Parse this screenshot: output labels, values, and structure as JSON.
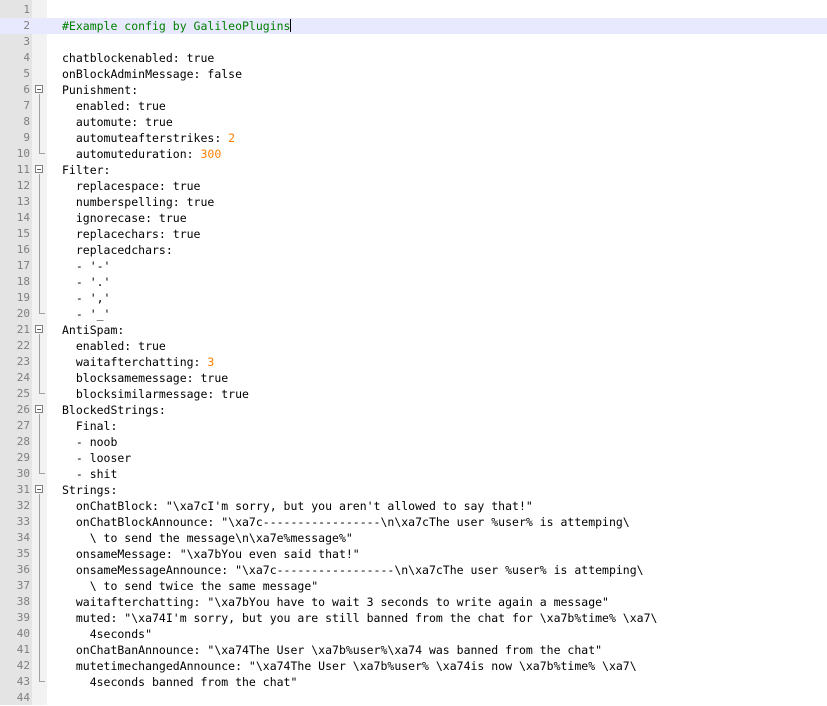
{
  "lines": [
    [],
    [
      {
        "t": "#Example config by GalileoPlugins",
        "c": "comment"
      }
    ],
    [],
    [
      {
        "t": "chatblockenabled: true"
      }
    ],
    [
      {
        "t": "onBlockAdminMessage: false"
      }
    ],
    [
      {
        "t": "Punishment:"
      }
    ],
    [
      {
        "t": "  enabled: true"
      }
    ],
    [
      {
        "t": "  automute: true"
      }
    ],
    [
      {
        "t": "  automuteafterstrikes: "
      },
      {
        "t": "2",
        "c": "num"
      }
    ],
    [
      {
        "t": "  automuteduration: "
      },
      {
        "t": "300",
        "c": "num"
      }
    ],
    [
      {
        "t": "Filter:"
      }
    ],
    [
      {
        "t": "  replacespace: true"
      }
    ],
    [
      {
        "t": "  numberspelling: true"
      }
    ],
    [
      {
        "t": "  ignorecase: true"
      }
    ],
    [
      {
        "t": "  replacechars: true"
      }
    ],
    [
      {
        "t": "  replacedchars:"
      }
    ],
    [
      {
        "t": "  - '-'"
      }
    ],
    [
      {
        "t": "  - '.'"
      }
    ],
    [
      {
        "t": "  - ','"
      }
    ],
    [
      {
        "t": "  - '_'"
      }
    ],
    [
      {
        "t": "AntiSpam:"
      }
    ],
    [
      {
        "t": "  enabled: true"
      }
    ],
    [
      {
        "t": "  waitafterchatting: "
      },
      {
        "t": "3",
        "c": "num"
      }
    ],
    [
      {
        "t": "  blocksamemessage: true"
      }
    ],
    [
      {
        "t": "  blocksimilarmessage: true"
      }
    ],
    [
      {
        "t": "BlockedStrings:"
      }
    ],
    [
      {
        "t": "  Final:"
      }
    ],
    [
      {
        "t": "  - noob"
      }
    ],
    [
      {
        "t": "  - looser"
      }
    ],
    [
      {
        "t": "  - shit"
      }
    ],
    [
      {
        "t": "Strings:"
      }
    ],
    [
      {
        "t": "  onChatBlock: \"\\xa7cI'm sorry, but you aren't allowed to say that!\""
      }
    ],
    [
      {
        "t": "  onChatBlockAnnounce: \"\\xa7c-----------------\\n\\xa7cThe user %user% is attemping\\"
      }
    ],
    [
      {
        "t": "    \\ to send the message\\n\\xa7e%message%\""
      }
    ],
    [
      {
        "t": "  onsameMessage: \"\\xa7bYou even said that!\""
      }
    ],
    [
      {
        "t": "  onsameMessageAnnounce: \"\\xa7c-----------------\\n\\xa7cThe user %user% is attemping\\"
      }
    ],
    [
      {
        "t": "    \\ to send twice the same message\""
      }
    ],
    [
      {
        "t": "  waitafterchatting: \"\\xa7bYou have to wait 3 seconds to write again a message\""
      }
    ],
    [
      {
        "t": "  muted: \"\\xa74I'm sorry, but you are still banned from the chat for \\xa7b%time% \\xa7\\"
      }
    ],
    [
      {
        "t": "    4seconds\""
      }
    ],
    [
      {
        "t": "  onChatBanAnnounce: \"\\xa74The User \\xa7b%user%\\xa74 was banned from the chat\""
      }
    ],
    [
      {
        "t": "  mutetimechangedAnnounce: \"\\xa74The User \\xa7b%user% \\xa74is now \\xa7b%time% \\xa7\\"
      }
    ],
    [
      {
        "t": "    4seconds banned from the chat\""
      }
    ],
    []
  ],
  "current_line": 2,
  "folds": {
    "6": "open",
    "7": "v",
    "8": "v",
    "9": "v",
    "10": "end",
    "11": "open",
    "12": "v",
    "13": "v",
    "14": "v",
    "15": "v",
    "16": "v",
    "17": "v",
    "18": "v",
    "19": "v",
    "20": "end",
    "21": "open",
    "22": "v",
    "23": "v",
    "24": "v",
    "25": "end",
    "26": "open",
    "27": "v",
    "28": "v",
    "29": "v",
    "30": "end",
    "31": "open",
    "32": "v",
    "33": "v",
    "34": "v",
    "35": "v",
    "36": "v",
    "37": "v",
    "38": "v",
    "39": "v",
    "40": "v",
    "41": "v",
    "42": "v",
    "43": "end"
  }
}
